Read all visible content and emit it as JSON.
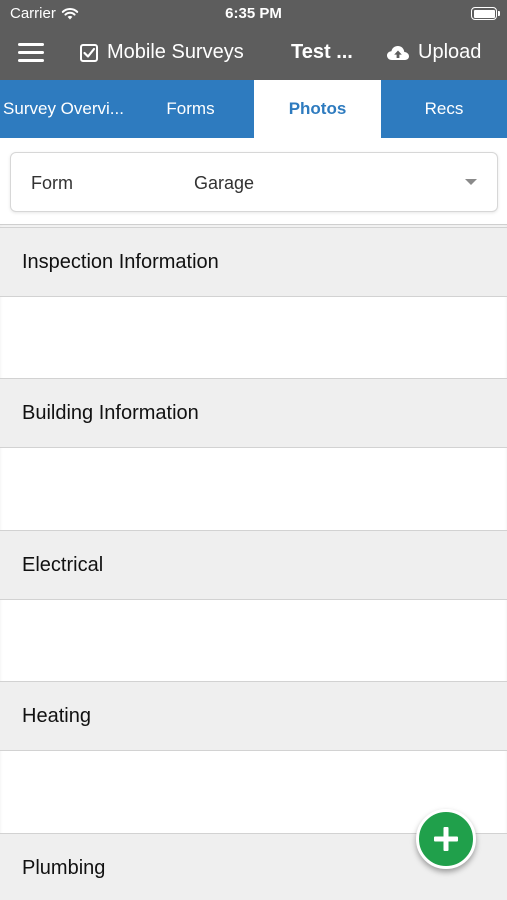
{
  "status_bar": {
    "carrier": "Carrier",
    "time": "6:35 PM",
    "battery_level": 1.0
  },
  "app_bar": {
    "menu_icon": "hamburger-menu-icon",
    "app_title": "Mobile Surveys",
    "app_icon": "checkbox-icon",
    "survey_name": "Test ...",
    "upload_label": "Upload",
    "upload_icon": "cloud-upload-icon"
  },
  "tabs": [
    {
      "label": "Survey Overvi...",
      "active": false
    },
    {
      "label": "Forms",
      "active": false
    },
    {
      "label": "Photos",
      "active": true
    },
    {
      "label": "Recs",
      "active": false
    }
  ],
  "form_selector": {
    "label": "Form",
    "value": "Garage"
  },
  "sections": [
    {
      "title": "Inspection Information"
    },
    {
      "title": "Building Information"
    },
    {
      "title": "Electrical"
    },
    {
      "title": "Heating"
    },
    {
      "title": "Plumbing"
    }
  ],
  "fab": {
    "icon": "plus-icon"
  },
  "colors": {
    "header_bg": "#5d5d5d",
    "tab_bg": "#2e7bbf",
    "section_bg": "#efefef",
    "fab_bg": "#20a04b"
  }
}
